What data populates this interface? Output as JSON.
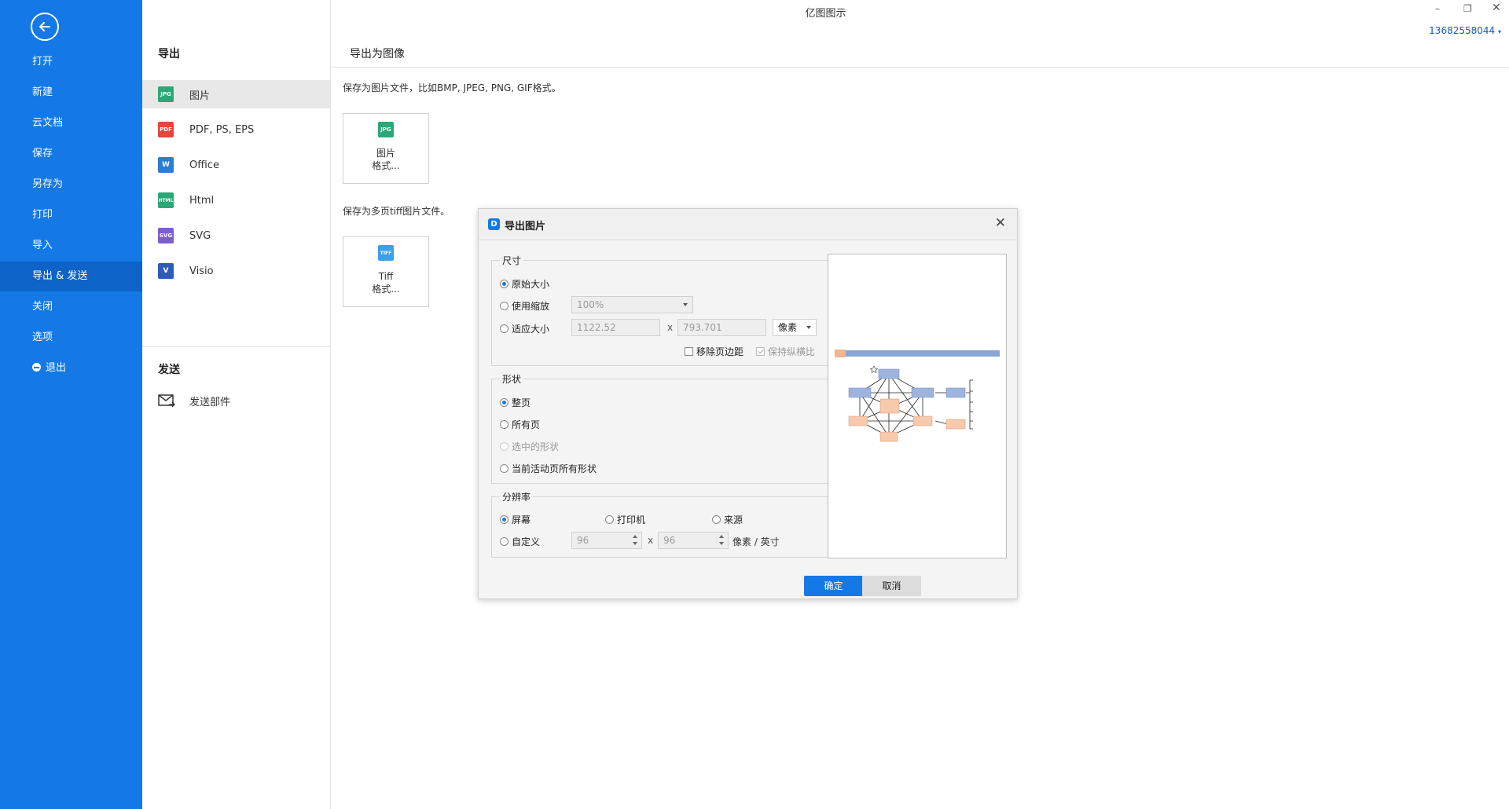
{
  "window": {
    "title": "亿图图示",
    "user": "13682558044"
  },
  "nav": {
    "items": [
      {
        "label": "打开"
      },
      {
        "label": "新建"
      },
      {
        "label": "云文档"
      },
      {
        "label": "保存"
      },
      {
        "label": "另存为"
      },
      {
        "label": "打印"
      },
      {
        "label": "导入"
      },
      {
        "label": "导出 & 发送",
        "active": true
      },
      {
        "label": "关闭"
      },
      {
        "label": "选项"
      },
      {
        "label": "退出"
      }
    ]
  },
  "export_panel": {
    "export_header": "导出",
    "options": [
      {
        "label": "图片",
        "icon": "JPG",
        "color": "#2aa876",
        "active": true
      },
      {
        "label": "PDF, PS, EPS",
        "icon": "PDF",
        "color": "#e8453c"
      },
      {
        "label": "Office",
        "icon": "W",
        "color": "#2b7cd3"
      },
      {
        "label": "Html",
        "icon": "HTML",
        "color": "#2aa876"
      },
      {
        "label": "SVG",
        "icon": "SVG",
        "color": "#7d5ccf"
      },
      {
        "label": "Visio",
        "icon": "V",
        "color": "#2c5bb8"
      }
    ],
    "send_header": "发送",
    "send_email": "发送部件"
  },
  "main": {
    "title": "导出为图像",
    "desc1": "保存为图片文件，比如BMP, JPEG, PNG, GIF格式。",
    "box1": {
      "icon": "JPG",
      "line1": "图片",
      "line2": "格式..."
    },
    "desc2": "保存为多页tiff图片文件。",
    "box2": {
      "icon": "TIFF",
      "line1": "Tiff",
      "line2": "格式..."
    }
  },
  "dialog": {
    "logo": "D",
    "title": "导出图片",
    "size": {
      "legend": "尺寸",
      "original": "原始大小",
      "use_zoom": "使用缩放",
      "zoom_value": "100%",
      "fit": "适应大小",
      "width": "1122.52",
      "x": "x",
      "height": "793.701",
      "unit": "像素",
      "remove_margin": "移除页边距",
      "keep_ratio": "保持纵横比"
    },
    "shape": {
      "legend": "形状",
      "whole_page": "整页",
      "all_pages": "所有页",
      "selected": "选中的形状",
      "current_page_all": "当前活动页所有形状"
    },
    "resolution": {
      "legend": "分辨率",
      "screen": "屏幕",
      "printer": "打印机",
      "source": "来源",
      "custom": "自定义",
      "dpi_x": "96",
      "x": "x",
      "dpi_y": "96",
      "unit": "像素 / 英寸"
    },
    "ok": "确定",
    "cancel": "取消"
  }
}
